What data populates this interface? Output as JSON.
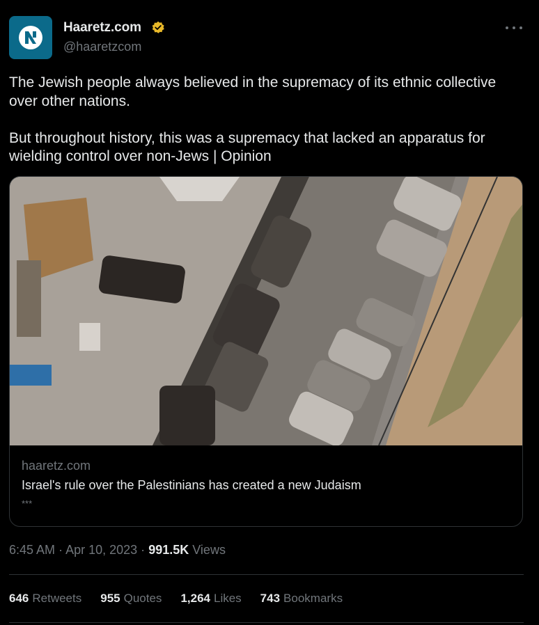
{
  "author": {
    "name": "Haaretz.com",
    "handle": "@haaretzcom",
    "verified_badge_color": "#e8b829"
  },
  "more_icon": "more-horizontal-icon",
  "tweet": {
    "text": "The Jewish people always believed in the supremacy of its ethnic collective over other nations.\n\nBut throughout history, this was a supremacy that lacked an apparatus for wielding control over non-Jews | Opinion"
  },
  "card": {
    "domain": "haaretz.com",
    "title": "Israel's rule over the Palestinians has created a new Judaism",
    "description": "***"
  },
  "meta": {
    "time": "6:45 AM",
    "date": "Apr 10, 2023",
    "separator": "·",
    "views_count": "991.5K",
    "views_label": "Views"
  },
  "stats": {
    "retweets": {
      "count": "646",
      "label": "Retweets"
    },
    "quotes": {
      "count": "955",
      "label": "Quotes"
    },
    "likes": {
      "count": "1,264",
      "label": "Likes"
    },
    "bookmarks": {
      "count": "743",
      "label": "Bookmarks"
    }
  },
  "colors": {
    "background": "#000000",
    "text": "#e7e9ea",
    "secondary": "#71767b",
    "border": "#2f3336",
    "avatar": "#0b6a8a"
  }
}
